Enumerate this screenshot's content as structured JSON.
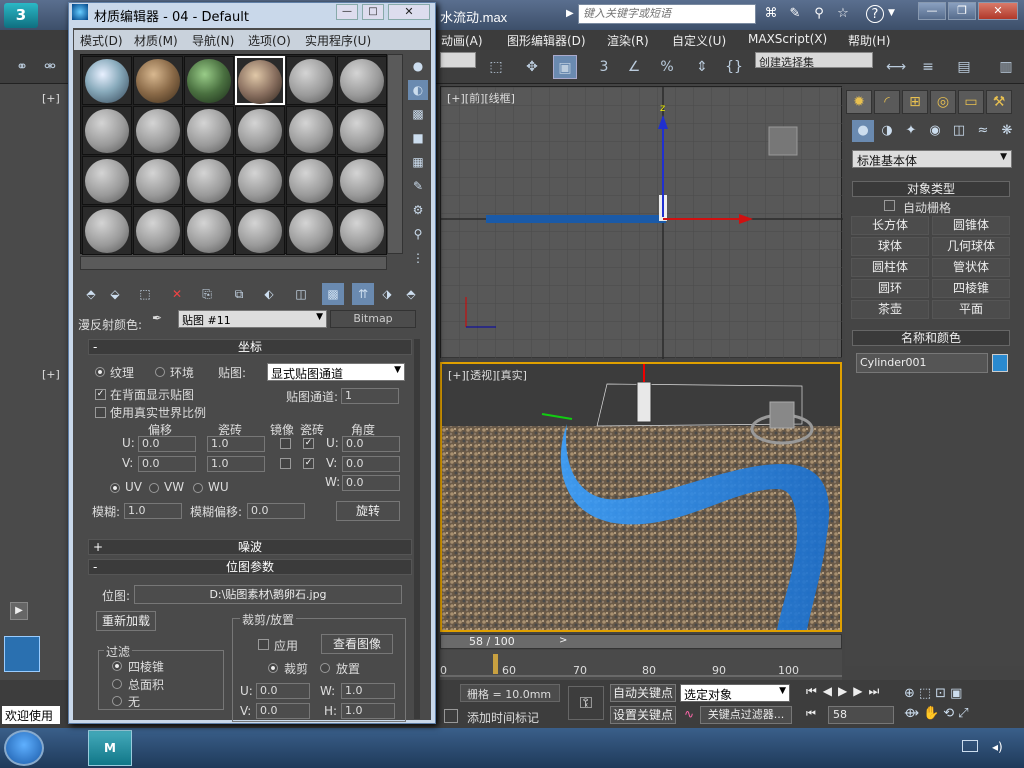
{
  "app": {
    "logo": "3",
    "file_title": "水流动.max",
    "search_placeholder": "键入关键字或短语",
    "win_min": "—",
    "win_max": "❐",
    "win_close": "✕"
  },
  "main_menu": [
    "动画(A)",
    "图形编辑器(D)",
    "渲染(R)",
    "自定义(U)",
    "MAXScript(X)",
    "帮助(H)"
  ],
  "toolbar": {
    "selection_set": "创建选择集"
  },
  "viewports": {
    "front_label": "[+][前][线框]",
    "persp_label": "[+][透视][真实]",
    "left_label_top": "[+]",
    "left_label_bottom": "[+]"
  },
  "command_panel": {
    "category": "标准基本体",
    "object_type_header": "对象类型",
    "autogrid": "自动栅格",
    "primitives": [
      "长方体",
      "圆锥体",
      "球体",
      "几何球体",
      "圆柱体",
      "管状体",
      "圆环",
      "四棱锥",
      "茶壶",
      "平面"
    ],
    "name_color_header": "名称和颜色",
    "object_name": "Cylinder001",
    "object_color": "#2a8ad0"
  },
  "timeline": {
    "frame": "58 / 100",
    "ruler_ticks": [
      "60",
      "70",
      "80",
      "90",
      "100"
    ],
    "first_tick": "0"
  },
  "bottom": {
    "grid": "栅格 = 10.0mm",
    "add_time_tag": "添加时间标记",
    "auto_key": "自动关键点",
    "set_key": "设置关键点",
    "selected_dropdown": "选定对象",
    "key_filters": "关键点过滤器...",
    "current_frame": "58",
    "status": "欢迎使用"
  },
  "material_editor": {
    "title": "材质编辑器 - 04 - Default",
    "menu": [
      "模式(D)",
      "材质(M)",
      "导航(N)",
      "选项(O)",
      "实用程序(U)"
    ],
    "diffuse_label": "漫反射颜色:",
    "map_name": "贴图 #11",
    "map_type": "Bitmap",
    "coords": {
      "header": "坐标",
      "texture": "纹理",
      "environ": "环境",
      "mapping_label": "贴图:",
      "mapping_value": "显式贴图通道",
      "show_map_back": "在背面显示贴图",
      "real_world": "使用真实世界比例",
      "map_channel_label": "贴图通道:",
      "map_channel": "1",
      "col_offset": "偏移",
      "col_tiling": "瓷砖",
      "col_mirror": "镜像",
      "col_tile": "瓷砖",
      "col_angle": "角度",
      "u_label": "U:",
      "v_label": "V:",
      "w_label": "W:",
      "u_offset": "0.0",
      "v_offset": "0.0",
      "u_tiling": "1.0",
      "v_tiling": "1.0",
      "u_angle": "0.0",
      "v_angle": "0.0",
      "w_angle": "0.0",
      "uv": "UV",
      "vw": "VW",
      "wu": "WU",
      "blur_label": "模糊:",
      "blur": "1.0",
      "blur_offset_label": "模糊偏移:",
      "blur_offset": "0.0",
      "rotate": "旋转"
    },
    "noise_header": "噪波",
    "bitmap_params": {
      "header": "位图参数",
      "bitmap_label": "位图:",
      "bitmap_path": "D:\\贴图素材\\鹅卵石.jpg",
      "reload": "重新加载",
      "crop_header": "裁剪/放置",
      "apply": "应用",
      "view_image": "查看图像",
      "crop": "裁剪",
      "place": "放置",
      "filter_header": "过滤",
      "pyramidal": "四棱锥",
      "summed_area": "总面积",
      "none": "无",
      "u_label": "U:",
      "v_label": "V:",
      "w_label": "W:",
      "h_label": "H:",
      "u": "0.0",
      "v": "0.0",
      "w": "1.0",
      "h": "1.0"
    }
  }
}
